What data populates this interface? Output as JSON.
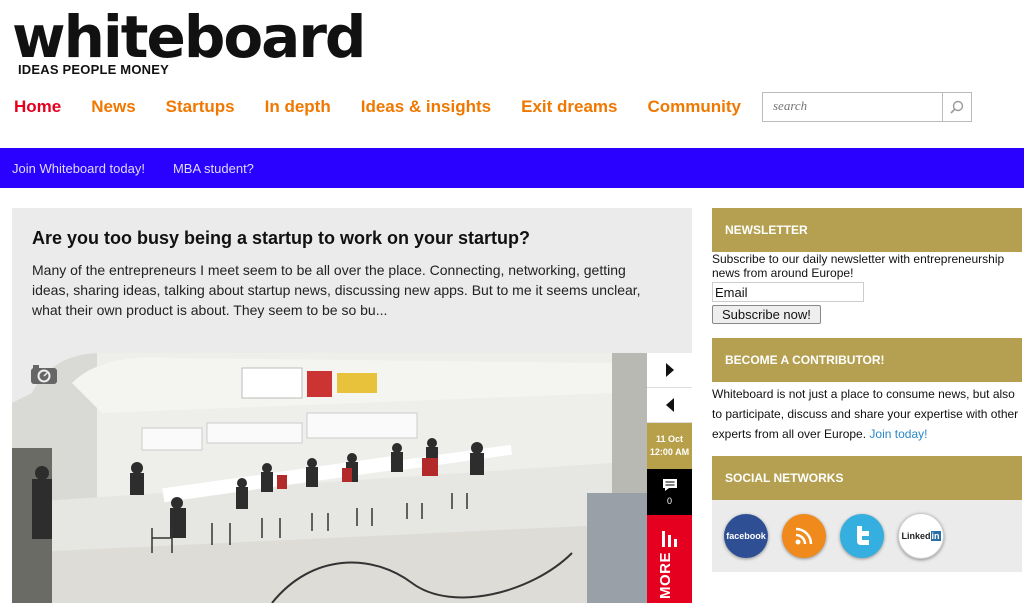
{
  "brand": {
    "logo_word": "whiteboard",
    "tagline": "IDEAS PEOPLE MONEY"
  },
  "nav": {
    "items": [
      {
        "label": "Home"
      },
      {
        "label": "News"
      },
      {
        "label": "Startups"
      },
      {
        "label": "In depth"
      },
      {
        "label": "Ideas & insights"
      },
      {
        "label": "Exit dreams"
      },
      {
        "label": "Community"
      }
    ]
  },
  "search": {
    "placeholder": "search"
  },
  "bluebar": {
    "links": [
      {
        "label": "Join Whiteboard today!"
      },
      {
        "label": "MBA student?"
      }
    ]
  },
  "article": {
    "title": "Are you too busy being a startup to work on your startup?",
    "excerpt": "Many of the entrepreneurs I meet seem to be all over the place. Connecting, networking, getting ideas, sharing ideas, talking about startup news, discussing new apps. But to me it seems unclear, what their own product is about. They seem to be so bu...",
    "date": "11 Oct",
    "time": "12:00 AM",
    "comment_count": "0",
    "more_label": "MORE",
    "photo_icon": "camera-icon"
  },
  "sidebar": {
    "newsletter": {
      "heading": "NEWSLETTER",
      "text": "Subscribe to our daily newsletter with entrepreneurship news from around Europe!",
      "input_value": "Email",
      "button": "Subscribe now!"
    },
    "contributor": {
      "heading": "BECOME A CONTRIBUTOR!",
      "text": "Whiteboard is not just a place to consume news, but also to participate, discuss and share your expertise with other experts from all over Europe.",
      "link": "Join today!"
    },
    "social": {
      "heading": "SOCIAL NETWORKS",
      "facebook": "facebook",
      "linkedin": "Linked"
    }
  },
  "colors": {
    "nav_orange": "#f07800",
    "nav_active": "#e5001f",
    "bluebar": "#2a00ff",
    "gold": "#b4a050",
    "red": "#e5001f"
  }
}
